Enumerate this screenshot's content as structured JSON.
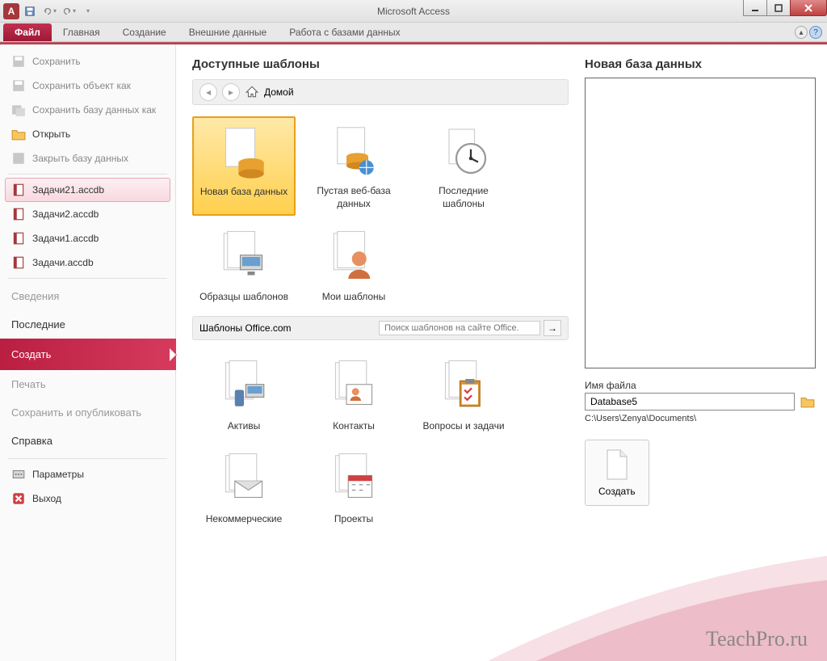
{
  "title": "Microsoft Access",
  "qat": {
    "app_letter": "A"
  },
  "ribbon": {
    "file": "Файл",
    "home": "Главная",
    "create": "Создание",
    "external": "Внешние данные",
    "dbtools": "Работа с базами данных"
  },
  "side": {
    "save": "Сохранить",
    "save_obj": "Сохранить объект как",
    "save_db": "Сохранить базу данных как",
    "open": "Открыть",
    "close_db": "Закрыть базу данных",
    "recent": [
      "Задачи21.accdb",
      "Задачи2.accdb",
      "Задачи1.accdb",
      "Задачи.accdb"
    ],
    "info": "Сведения",
    "recent_h": "Последние",
    "new": "Создать",
    "print": "Печать",
    "save_pub": "Сохранить и опубликовать",
    "help": "Справка",
    "options": "Параметры",
    "exit": "Выход"
  },
  "center": {
    "heading": "Доступные шаблоны",
    "home": "Домой",
    "row1": [
      {
        "label": "Новая база данных"
      },
      {
        "label": "Пустая веб-база данных"
      },
      {
        "label": "Последние шаблоны"
      }
    ],
    "row2": [
      {
        "label": "Образцы шаблонов"
      },
      {
        "label": "Мои шаблоны"
      }
    ],
    "office_hdr": "Шаблоны Office.com",
    "search_ph": "Поиск шаблонов на сайте Office.",
    "row3": [
      {
        "label": "Активы"
      },
      {
        "label": "Контакты"
      },
      {
        "label": "Вопросы и задачи"
      }
    ],
    "row4": [
      {
        "label": "Некоммерческие"
      },
      {
        "label": "Проекты"
      }
    ]
  },
  "right": {
    "heading": "Новая база данных",
    "file_label": "Имя файла",
    "file_value": "Database5",
    "path": "C:\\Users\\Zenya\\Documents\\",
    "create": "Создать"
  },
  "watermark": "TeachPro.ru"
}
